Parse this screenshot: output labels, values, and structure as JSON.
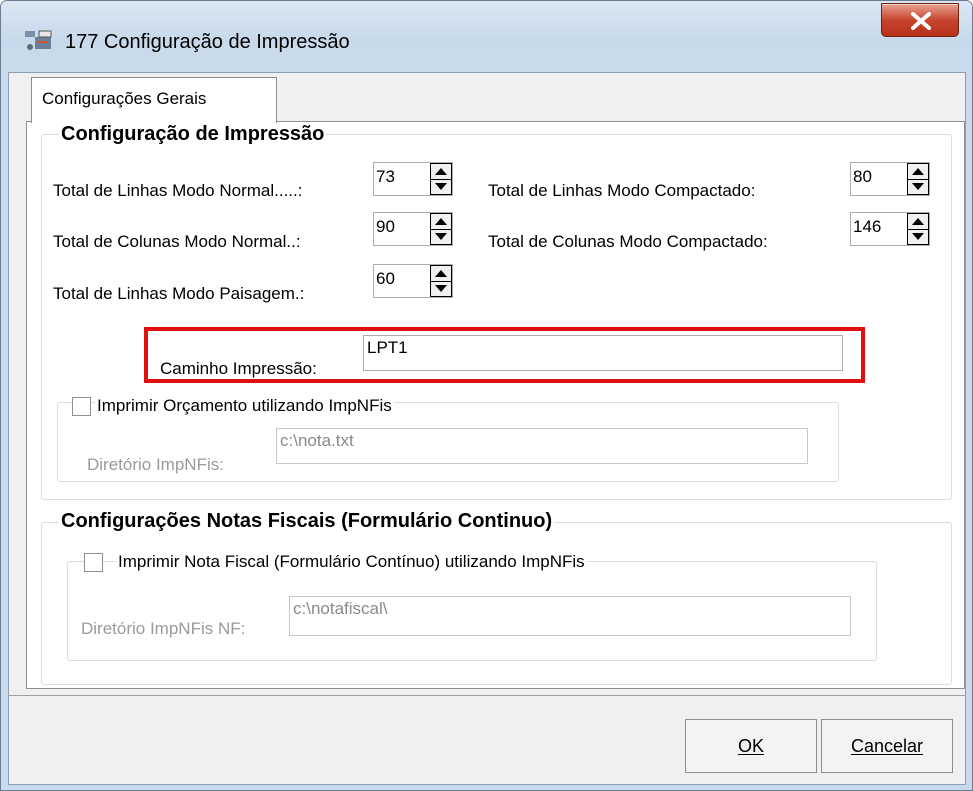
{
  "window": {
    "title": "177 Configuração de Impressão",
    "icon": "printer-settings-icon",
    "close_icon": "close-icon"
  },
  "tabs": [
    {
      "label": "Configurações Gerais",
      "selected": true
    }
  ],
  "print_group": {
    "title": "Configuração de Impressão",
    "fields": [
      {
        "label": "Total de Linhas Modo Normal.....:",
        "value": "73"
      },
      {
        "label": "Total de Colunas Modo Normal..:",
        "value": "90"
      },
      {
        "label": "Total de Linhas Modo Paisagem.:",
        "value": "60"
      },
      {
        "label": "Total de Linhas Modo Compactado:",
        "value": "80"
      },
      {
        "label": "Total de Colunas Modo Compactado:",
        "value": "146"
      }
    ],
    "path_label": "Caminho Impressão:",
    "path_value": "LPT1",
    "impnfis_checkbox_label": "Imprimir Orçamento utilizando ImpNFis",
    "impnfis_checked": false,
    "impnfis_dir_label": "Diretório ImpNFis:",
    "impnfis_dir_value": "c:\\nota.txt"
  },
  "nf_group": {
    "title": "Configurações Notas Fiscais (Formulário Continuo)",
    "checkbox_label": "Imprimir Nota Fiscal (Formulário Contínuo) utilizando ImpNFis",
    "checked": false,
    "dir_label": "Diretório ImpNFis NF:",
    "dir_value": "c:\\notafiscal\\"
  },
  "buttons": {
    "ok": "OK",
    "cancel": "Cancelar"
  },
  "colors": {
    "highlight": "#e01010",
    "close_button": "#c7452e",
    "title_bar": "#c9daeb"
  }
}
